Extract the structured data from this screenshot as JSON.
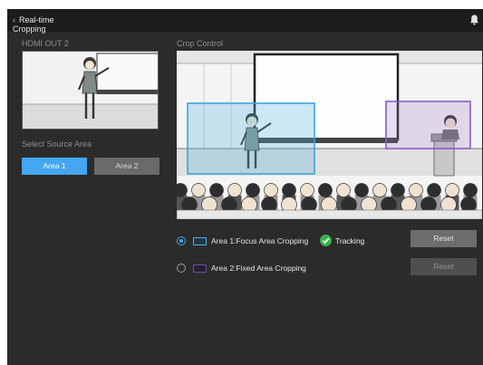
{
  "topbar": {
    "title": "Real-time Cropping",
    "back_icon": "chevron-left-icon",
    "bell_icon": "bell-icon"
  },
  "left": {
    "hdmi_label": "HDMI OUT  2",
    "select_label": "Select Source Area",
    "area_buttons": [
      "Area 1",
      "Area 2"
    ],
    "selected_area": "Area 1"
  },
  "crop": {
    "label": "Crop Control",
    "areas": [
      {
        "label": "Area 1:Focus Area Cropping",
        "selected": true,
        "color": "#4ab2e0",
        "status": "Tracking",
        "status_icon": "check-circle-icon",
        "status_color": "#37b24d",
        "reset": "Reset",
        "reset_enabled": true
      },
      {
        "label": "Area 2:Fixed Area Cropping",
        "selected": false,
        "color": "#6e4fa0",
        "reset": "Reset",
        "reset_enabled": false
      }
    ]
  },
  "colors": {
    "accent": "#45a6f1",
    "panel_bg": "#2b2b2b",
    "topbar_bg": "#1c1c1c"
  }
}
